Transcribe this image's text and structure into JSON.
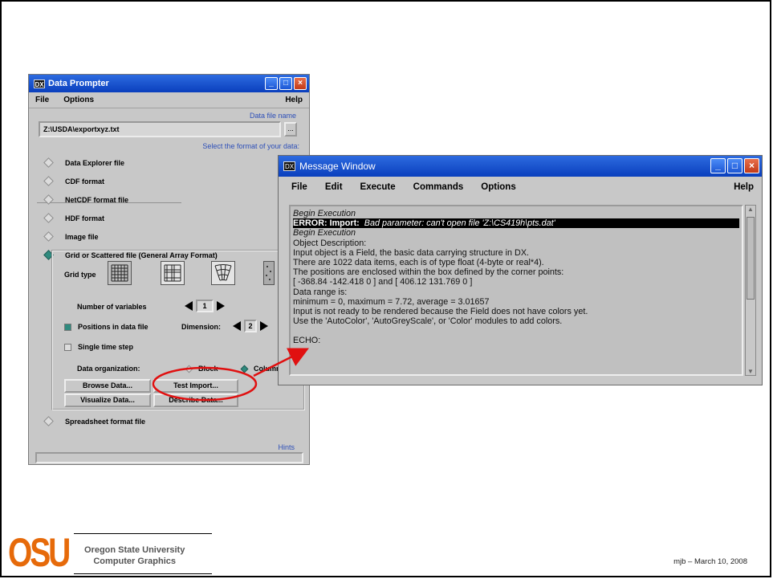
{
  "data_prompter": {
    "title": "Data Prompter",
    "app_icon": "DX",
    "menu": {
      "file": "File",
      "options": "Options",
      "help": "Help"
    },
    "data_file_label": "Data file name",
    "data_file_value": "Z:\\USDA\\exportxyz.txt",
    "browse_dots": "...",
    "format_label": "Select the format of your data:",
    "formats": [
      {
        "label": "Data Explorer file",
        "selected": false
      },
      {
        "label": "CDF format",
        "selected": false
      },
      {
        "label": "NetCDF format file",
        "selected": false
      },
      {
        "label": "HDF format",
        "selected": false
      },
      {
        "label": "Image file",
        "selected": false
      },
      {
        "label": "Grid or Scattered file (General Array Format)",
        "selected": true
      }
    ],
    "grid_type_label": "Grid type",
    "num_vars_label": "Number of variables",
    "num_vars_value": "1",
    "positions_label": "Positions in data file",
    "positions_checked": true,
    "dimension_label": "Dimension:",
    "dimension_value": "2",
    "single_step_label": "Single time step",
    "single_step_checked": false,
    "data_org_label": "Data organization:",
    "block_label": "Block",
    "columnar_label": "Columna",
    "buttons": {
      "browse": "Browse Data...",
      "test_import": "Test Import...",
      "visualize": "Visualize Data...",
      "describe": "Describe Data..."
    },
    "spreadsheet_label": "Spreadsheet format file",
    "hints_label": "Hints"
  },
  "message_window": {
    "title": "Message Window",
    "app_icon": "DX",
    "menu": [
      "File",
      "Edit",
      "Execute",
      "Commands",
      "Options"
    ],
    "help": "Help",
    "log": {
      "line1": "Begin Execution",
      "error_prefix": "ERROR: Import:",
      "error_msg": "Bad parameter: can't open file 'Z:\\CS419h\\pts.dat'",
      "line3": "Begin Execution",
      "line4": "Object Description:",
      "line5": "Input object is a Field, the basic data carrying structure in DX.",
      "line6": "There are 1022 data items, each is of type float (4-byte or real*4).",
      "line7": "The positions are enclosed within the box defined by the corner points:",
      "line8": "[ -368.84 -142.418 0 ] and [ 406.12 131.769 0 ]",
      "line9": "Data range is:",
      "line10": "minimum = 0, maximum = 7.72, average = 3.01657",
      "line11": "Input is not ready to be rendered because the Field does not have colors yet.",
      "line12": "Use the 'AutoColor', 'AutoGreyScale', or 'Color' modules to add colors.",
      "line13": "",
      "line14": "ECHO:"
    }
  },
  "footer": {
    "logo": "OSU",
    "university": "Oregon State University",
    "department": "Computer Graphics",
    "date": "mjb – March 10, 2008"
  },
  "colors": {
    "titlebar": "#0a3fbd",
    "osu_orange": "#e66a0a",
    "annotation_red": "#e01010"
  }
}
